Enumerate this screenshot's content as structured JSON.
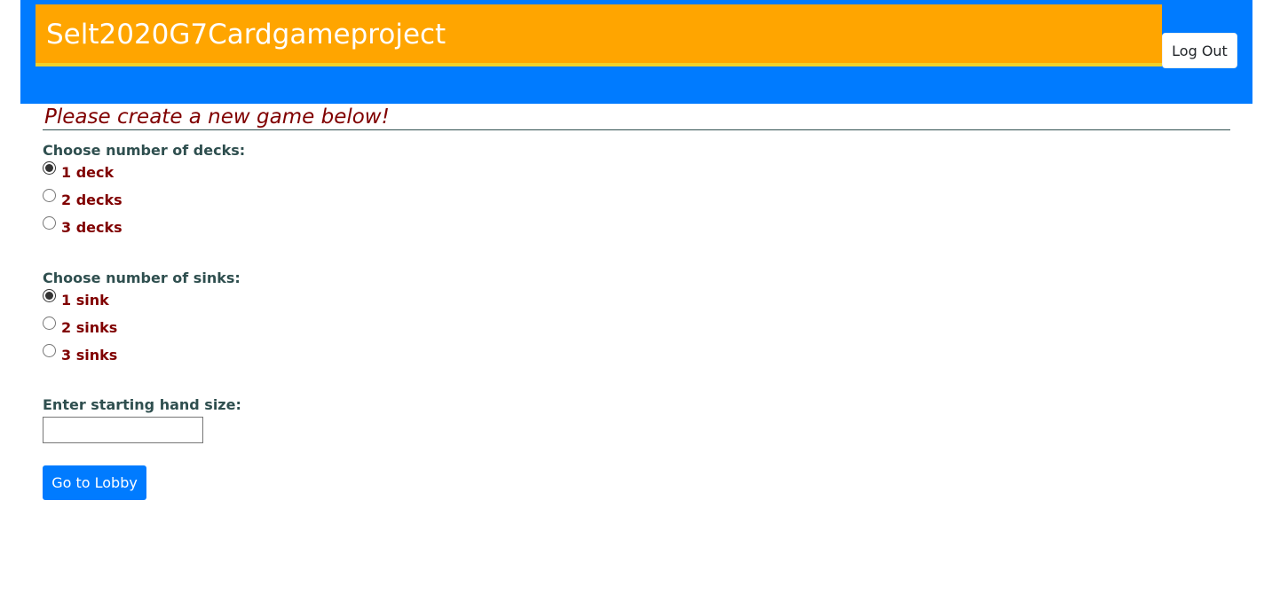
{
  "header": {
    "app_title": "Selt2020G7Cardgameproject",
    "logout_label": "Log Out",
    "colors": {
      "header_bg": "#007bff",
      "title_bar_bg": "#ffa500",
      "title_bar_accent": "#f0d12a"
    }
  },
  "form": {
    "heading": "Please create a new game below!",
    "decks": {
      "label": "Choose number of decks:",
      "selected": "1 deck",
      "options": [
        "1 deck",
        "2 decks",
        "3 decks"
      ]
    },
    "sinks": {
      "label": "Choose number of sinks:",
      "selected": "1 sink",
      "options": [
        "1 sink",
        "2 sinks",
        "3 sinks"
      ]
    },
    "hand_size": {
      "label": "Enter starting hand size:",
      "value": ""
    },
    "submit_label": "Go to Lobby",
    "colors": {
      "heading": "#800000",
      "label": "#2f4f4f",
      "option": "#800000",
      "button": "#007bff"
    }
  }
}
